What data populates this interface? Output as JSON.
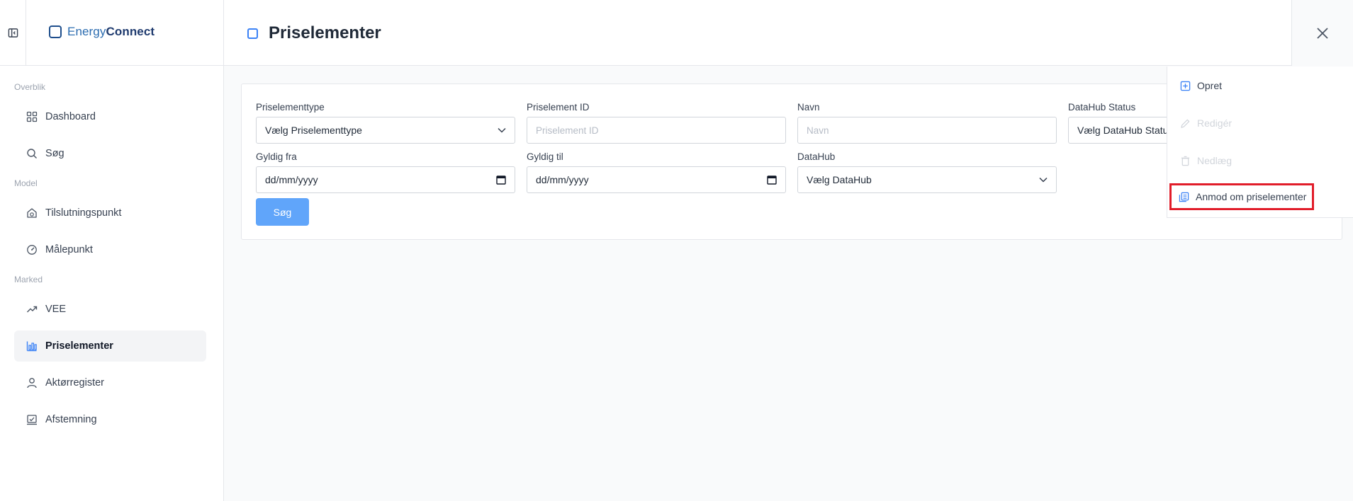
{
  "app": {
    "logo_light": "Energy",
    "logo_bold": "Connect"
  },
  "sidebar": {
    "sections": {
      "overview": "Overblik",
      "model": "Model",
      "market": "Marked"
    },
    "items": [
      {
        "label": "Dashboard",
        "icon": "grid-icon"
      },
      {
        "label": "Søg",
        "icon": "search-icon"
      },
      {
        "label": "Tilslutningspunkt",
        "icon": "house-plug-icon"
      },
      {
        "label": "Målepunkt",
        "icon": "gauge-icon"
      },
      {
        "label": "VEE",
        "icon": "trend-up-icon"
      },
      {
        "label": "Priselementer",
        "icon": "price-chart-icon",
        "active": true
      },
      {
        "label": "Aktørregister",
        "icon": "user-icon"
      },
      {
        "label": "Afstemning",
        "icon": "reconcile-icon"
      }
    ]
  },
  "header": {
    "title": "Priselementer"
  },
  "filters": {
    "type": {
      "label": "Priselementtype",
      "value": "Vælg Priselementtype"
    },
    "id": {
      "label": "Priselement ID",
      "placeholder": "Priselement ID"
    },
    "name": {
      "label": "Navn",
      "placeholder": "Navn"
    },
    "datahub_status": {
      "label": "DataHub Status",
      "value": "Vælg DataHub Status"
    },
    "valid_from": {
      "label": "Gyldig fra",
      "value": "dd/mm/yyyy"
    },
    "valid_to": {
      "label": "Gyldig til",
      "value": "dd/mm/yyyy"
    },
    "datahub": {
      "label": "DataHub",
      "value": "Vælg DataHub"
    },
    "search_label": "Søg"
  },
  "actions": {
    "create": "Opret",
    "edit": "Redigér",
    "discontinue": "Nedlæg",
    "request": "Anmod om priselementer"
  },
  "colors": {
    "accent": "#3b82f6",
    "button": "#60a5fa",
    "highlight": "#e11d2a",
    "logo": "#1e4e8c"
  }
}
